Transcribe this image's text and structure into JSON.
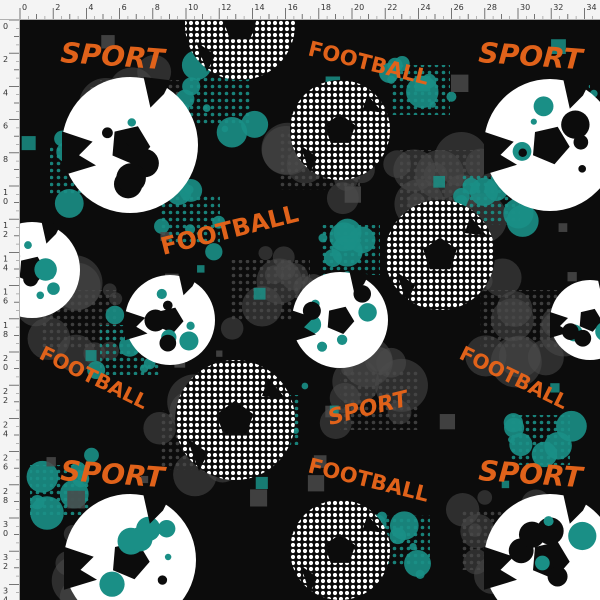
{
  "ruler": {
    "unit": "cm",
    "top_labels": [
      "0",
      "2",
      "4",
      "6",
      "8",
      "10",
      "12",
      "14",
      "16",
      "18",
      "20",
      "22",
      "24",
      "26",
      "28",
      "30",
      "32",
      "34"
    ],
    "left_labels": [
      "0",
      "2",
      "4",
      "6",
      "8",
      "1 0",
      "1 2",
      "1 4",
      "1 6",
      "1 8",
      "2 0",
      "2 2",
      "2 4",
      "2 6",
      "2 8",
      "3 0",
      "3 2",
      "3 4"
    ]
  },
  "pattern": {
    "background_color": "#0c0c0c",
    "accent_teal": "#1a8f86",
    "accent_gray": "#4a4a4a",
    "text_orange": "#e0621a",
    "ball_white": "#ffffff",
    "words": [
      "SPORT",
      "FOOTBALL"
    ]
  }
}
